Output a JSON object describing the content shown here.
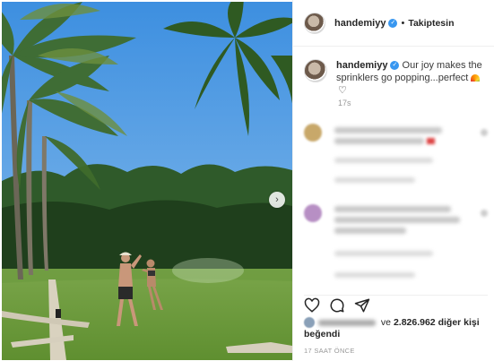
{
  "post": {
    "username": "handemiyy",
    "follow_status": "Takiptesin",
    "separator": "•",
    "caption_username": "handemiyy",
    "caption_text": "Our joy makes the sprinklers go popping...perfect",
    "caption_time": "17s",
    "likes_prefix": "ve",
    "likes_count": "2.826.962",
    "likes_suffix": "diğer kişi",
    "liked_word": "beğendi",
    "time_ago": "17 SAAT ÖNCE"
  },
  "icons": {
    "verified": "verified-badge-icon",
    "next": "chevron-right-icon",
    "heart": "heart-icon",
    "comment": "comment-icon",
    "share": "paper-plane-icon"
  },
  "colors": {
    "verified_blue": "#3897f0",
    "text": "#262626",
    "muted": "#999999"
  }
}
